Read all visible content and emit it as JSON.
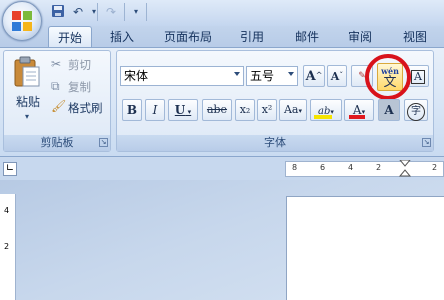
{
  "quick_access": {
    "save_icon": "save-icon",
    "undo_icon": "undo-icon",
    "redo_icon": "redo-icon",
    "customize_icon": "customize-icon"
  },
  "tabs": [
    {
      "label": "开始",
      "active": true
    },
    {
      "label": "插入"
    },
    {
      "label": "页面布局"
    },
    {
      "label": "引用"
    },
    {
      "label": "邮件"
    },
    {
      "label": "审阅"
    },
    {
      "label": "视图"
    }
  ],
  "clipboard": {
    "paste_label": "粘贴",
    "cut_label": "剪切",
    "copy_label": "复制",
    "format_painter_label": "格式刷",
    "group_label": "剪贴板"
  },
  "font": {
    "font_name": "宋体",
    "font_size": "五号",
    "grow_label": "A",
    "shrink_label": "A",
    "bold": "B",
    "italic": "I",
    "underline": "U",
    "strikethrough": "abe",
    "subscript": "x₂",
    "superscript": "x²",
    "change_case": "Aa",
    "highlight": "ab",
    "font_color": "A",
    "char_shading": "A",
    "enclose": "字",
    "phonetic_top": "wén",
    "phonetic_bottom": "文",
    "group_label": "字体"
  },
  "ruler": {
    "numbers": [
      "8",
      "6",
      "4",
      "2",
      "2"
    ],
    "vertical_numbers": [
      "4",
      "2"
    ]
  },
  "colors": {
    "annotation_circle": "#d8121b",
    "font_color_bar": "#e0191f",
    "highlight_bar": "#f5e400"
  }
}
